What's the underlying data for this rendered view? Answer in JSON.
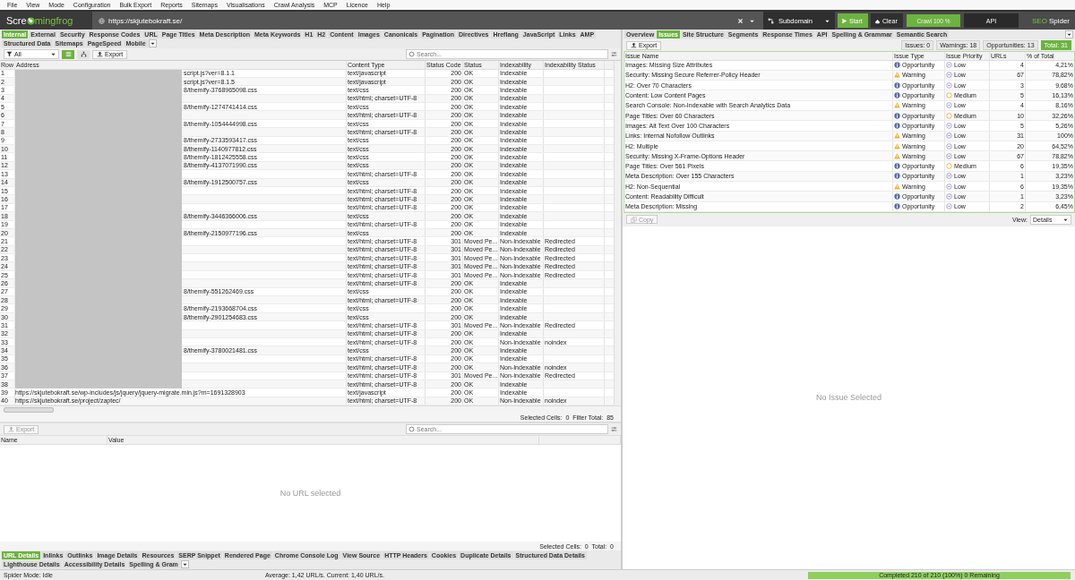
{
  "menu": [
    "File",
    "View",
    "Mode",
    "Configuration",
    "Bulk Export",
    "Reports",
    "Sitemaps",
    "Visualisations",
    "Crawl Analysis",
    "MCP",
    "Licence",
    "Help"
  ],
  "topbar": {
    "logo": [
      "Scre",
      "mingfrog"
    ],
    "url": "https://skjutebokraft.se/",
    "mode": "Subdomain",
    "start": "Start",
    "clear": "Clear",
    "crawl": {
      "label": "Crawl 100 %",
      "level": 1
    },
    "api": "API",
    "brand": [
      "SEO",
      "Spider"
    ]
  },
  "left": {
    "tabs": [
      {
        "label": "Internal",
        "selected": true
      },
      {
        "label": "External",
        "selected": false
      },
      {
        "label": "Security",
        "selected": false
      },
      {
        "label": "Response Codes",
        "selected": false
      },
      {
        "label": "URL",
        "selected": false
      },
      {
        "label": "Page Titles",
        "selected": false
      },
      {
        "label": "Meta Description",
        "selected": false
      },
      {
        "label": "Meta Keywords",
        "selected": false
      },
      {
        "label": "H1",
        "selected": false
      },
      {
        "label": "H2",
        "selected": false
      },
      {
        "label": "Content",
        "selected": false
      },
      {
        "label": "Images",
        "selected": false
      },
      {
        "label": "Canonicals",
        "selected": false
      },
      {
        "label": "Pagination",
        "selected": false
      },
      {
        "label": "Directives",
        "selected": false
      },
      {
        "label": "Hreflang",
        "selected": false
      },
      {
        "label": "JavaScript",
        "selected": false
      },
      {
        "label": "Links",
        "selected": false
      },
      {
        "label": "AMP",
        "selected": false
      },
      {
        "label": "Structured Data",
        "selected": false
      },
      {
        "label": "Sitemaps",
        "selected": false
      },
      {
        "label": "PageSpeed",
        "selected": false
      },
      {
        "label": "Mobile",
        "selected": false
      }
    ],
    "filter": "All",
    "views": [
      {
        "kind": "list",
        "selected": true
      },
      {
        "kind": "tree",
        "selected": false
      }
    ],
    "export": "Export",
    "search": {
      "placeholder": "Search..."
    },
    "table": {
      "columns": [
        "Row",
        "Address",
        "Content Type",
        "Status Code",
        "Status",
        "Indexability",
        "Indexability Status"
      ],
      "rows": [
        {
          "redacted": true,
          "cells": [
            "1",
            "script.js?ver=8.1.1",
            "text/javascript",
            "200",
            "OK",
            "Indexable",
            ""
          ]
        },
        {
          "redacted": true,
          "cells": [
            "2",
            "script.js?ver=8.1.5",
            "text/javascript",
            "200",
            "OK",
            "Indexable",
            ""
          ]
        },
        {
          "redacted": true,
          "cells": [
            "3",
            "8/themify-3768965098.css",
            "text/css",
            "200",
            "OK",
            "Indexable",
            ""
          ]
        },
        {
          "redacted": true,
          "cells": [
            "4",
            "",
            "text/html; charset=UTF-8",
            "200",
            "OK",
            "Indexable",
            ""
          ]
        },
        {
          "redacted": true,
          "cells": [
            "5",
            "8/themify-1274741414.css",
            "text/css",
            "200",
            "OK",
            "Indexable",
            ""
          ]
        },
        {
          "redacted": true,
          "cells": [
            "6",
            "",
            "text/html; charset=UTF-8",
            "200",
            "OK",
            "Indexable",
            ""
          ]
        },
        {
          "redacted": true,
          "cells": [
            "7",
            "8/themify-1054444998.css",
            "text/css",
            "200",
            "OK",
            "Indexable",
            ""
          ]
        },
        {
          "redacted": true,
          "cells": [
            "8",
            "",
            "text/html; charset=UTF-8",
            "200",
            "OK",
            "Indexable",
            ""
          ]
        },
        {
          "redacted": true,
          "cells": [
            "9",
            "8/themify-2733593417.css",
            "text/css",
            "200",
            "OK",
            "Indexable",
            ""
          ]
        },
        {
          "redacted": true,
          "cells": [
            "10",
            "8/themify-1140977812.css",
            "text/css",
            "200",
            "OK",
            "Indexable",
            ""
          ]
        },
        {
          "redacted": true,
          "cells": [
            "11",
            "8/themify-1812425558.css",
            "text/css",
            "200",
            "OK",
            "Indexable",
            ""
          ]
        },
        {
          "redacted": true,
          "cells": [
            "12",
            "8/themify-4137071990.css",
            "text/css",
            "200",
            "OK",
            "Indexable",
            ""
          ]
        },
        {
          "redacted": true,
          "cells": [
            "13",
            "",
            "text/html; charset=UTF-8",
            "200",
            "OK",
            "Indexable",
            ""
          ]
        },
        {
          "redacted": true,
          "cells": [
            "14",
            "8/themify-1912500757.css",
            "text/css",
            "200",
            "OK",
            "Indexable",
            ""
          ]
        },
        {
          "redacted": true,
          "cells": [
            "15",
            "",
            "text/html; charset=UTF-8",
            "200",
            "OK",
            "Indexable",
            ""
          ]
        },
        {
          "redacted": true,
          "cells": [
            "16",
            "",
            "text/html; charset=UTF-8",
            "200",
            "OK",
            "Indexable",
            ""
          ]
        },
        {
          "redacted": true,
          "cells": [
            "17",
            "",
            "text/html; charset=UTF-8",
            "200",
            "OK",
            "Indexable",
            ""
          ]
        },
        {
          "redacted": true,
          "cells": [
            "18",
            "8/themify-3446366006.css",
            "text/css",
            "200",
            "OK",
            "Indexable",
            ""
          ]
        },
        {
          "redacted": true,
          "cells": [
            "19",
            "",
            "text/html; charset=UTF-8",
            "200",
            "OK",
            "Indexable",
            ""
          ]
        },
        {
          "redacted": true,
          "cells": [
            "20",
            "8/themify-2150977196.css",
            "text/css",
            "200",
            "OK",
            "Indexable",
            ""
          ]
        },
        {
          "redacted": true,
          "cells": [
            "21",
            "",
            "text/html; charset=UTF-8",
            "301",
            "Moved Pe...",
            "Non-Indexable",
            "Redirected"
          ]
        },
        {
          "redacted": true,
          "cells": [
            "22",
            "",
            "text/html; charset=UTF-8",
            "301",
            "Moved Pe...",
            "Non-Indexable",
            "Redirected"
          ]
        },
        {
          "redacted": true,
          "cells": [
            "23",
            "",
            "text/html; charset=UTF-8",
            "301",
            "Moved Pe...",
            "Non-Indexable",
            "Redirected"
          ]
        },
        {
          "redacted": true,
          "cells": [
            "24",
            "",
            "text/html; charset=UTF-8",
            "301",
            "Moved Pe...",
            "Non-Indexable",
            "Redirected"
          ]
        },
        {
          "redacted": true,
          "cells": [
            "25",
            "",
            "text/html; charset=UTF-8",
            "301",
            "Moved Pe...",
            "Non-Indexable",
            "Redirected"
          ]
        },
        {
          "redacted": true,
          "cells": [
            "26",
            "",
            "text/html; charset=UTF-8",
            "200",
            "OK",
            "Indexable",
            ""
          ]
        },
        {
          "redacted": true,
          "cells": [
            "27",
            "8/themify-551262469.css",
            "text/css",
            "200",
            "OK",
            "Indexable",
            ""
          ]
        },
        {
          "redacted": true,
          "cells": [
            "28",
            "",
            "text/html; charset=UTF-8",
            "200",
            "OK",
            "Indexable",
            ""
          ]
        },
        {
          "redacted": true,
          "cells": [
            "29",
            "8/themify-2193668704.css",
            "text/css",
            "200",
            "OK",
            "Indexable",
            ""
          ]
        },
        {
          "redacted": true,
          "cells": [
            "30",
            "8/themify-2901254683.css",
            "text/css",
            "200",
            "OK",
            "Indexable",
            ""
          ]
        },
        {
          "redacted": true,
          "cells": [
            "31",
            "",
            "text/html; charset=UTF-8",
            "301",
            "Moved Pe...",
            "Non-Indexable",
            "Redirected"
          ]
        },
        {
          "redacted": true,
          "cells": [
            "32",
            "",
            "text/html; charset=UTF-8",
            "200",
            "OK",
            "Indexable",
            ""
          ]
        },
        {
          "redacted": true,
          "cells": [
            "33",
            "",
            "text/html; charset=UTF-8",
            "200",
            "OK",
            "Non-Indexable",
            "noindex"
          ]
        },
        {
          "redacted": true,
          "cells": [
            "34",
            "8/themify-3780021481.css",
            "text/css",
            "200",
            "OK",
            "Indexable",
            ""
          ]
        },
        {
          "redacted": true,
          "cells": [
            "35",
            "",
            "text/html; charset=UTF-8",
            "200",
            "OK",
            "Indexable",
            ""
          ]
        },
        {
          "redacted": true,
          "cells": [
            "36",
            "",
            "text/html; charset=UTF-8",
            "200",
            "OK",
            "Non-Indexable",
            "noindex"
          ]
        },
        {
          "redacted": true,
          "cells": [
            "37",
            "",
            "text/html; charset=UTF-8",
            "301",
            "Moved Pe...",
            "Non-Indexable",
            "Redirected"
          ]
        },
        {
          "redacted": true,
          "cells": [
            "38",
            "",
            "text/html; charset=UTF-8",
            "200",
            "OK",
            "Indexable",
            ""
          ]
        },
        {
          "redacted": false,
          "cells": [
            "39",
            "https://skjutebokraft.se/wp-includes/js/jquery/jquery-migrate.min.js?m=1691328903",
            "text/javascript",
            "200",
            "OK",
            "Indexable",
            ""
          ]
        },
        {
          "redacted": false,
          "cells": [
            "40",
            "https://skjutebokraft.se/project/zaptec/",
            "text/html; charset=UTF-8",
            "200",
            "OK",
            "Non-Indexable",
            "noindex"
          ]
        }
      ]
    },
    "summary": "Selected Cells:  0  Filter Total:  85"
  },
  "details": {
    "export": "Export",
    "search": {
      "placeholder": "Search..."
    },
    "columns": [
      "Name",
      "Value"
    ],
    "empty": "No URL selected",
    "summary": "Selected Cells:  0  Total:  0",
    "tabs": [
      {
        "label": "URL Details",
        "selected": true
      },
      {
        "label": "Inlinks",
        "selected": false
      },
      {
        "label": "Outlinks",
        "selected": false
      },
      {
        "label": "Image Details",
        "selected": false
      },
      {
        "label": "Resources",
        "selected": false
      },
      {
        "label": "SERP Snippet",
        "selected": false
      },
      {
        "label": "Rendered Page",
        "selected": false
      },
      {
        "label": "Chrome Console Log",
        "selected": false
      },
      {
        "label": "View Source",
        "selected": false
      },
      {
        "label": "HTTP Headers",
        "selected": false
      },
      {
        "label": "Cookies",
        "selected": false
      },
      {
        "label": "Duplicate Details",
        "selected": false
      },
      {
        "label": "Structured Data Details",
        "selected": false
      },
      {
        "label": "Lighthouse Details",
        "selected": false
      },
      {
        "label": "Accessibility Details",
        "selected": false
      },
      {
        "label": "Spelling & Gram",
        "selected": false
      }
    ]
  },
  "right": {
    "tabs": [
      {
        "label": "Overview",
        "selected": false
      },
      {
        "label": "Issues",
        "selected": true
      },
      {
        "label": "Site Structure",
        "selected": false
      },
      {
        "label": "Segments",
        "selected": false
      },
      {
        "label": "Response Times",
        "selected": false
      },
      {
        "label": "API",
        "selected": false
      },
      {
        "label": "Spelling & Grammar",
        "selected": false
      },
      {
        "label": "Semantic Search",
        "selected": false
      }
    ],
    "export": "Export",
    "counters": [
      {
        "label": "Issues: 0",
        "selected": false
      },
      {
        "label": "Warnings: 18",
        "selected": false
      },
      {
        "label": "Opportunities: 13",
        "selected": false
      },
      {
        "label": "Total: 31",
        "selected": true
      }
    ],
    "columns": [
      "Issue Name",
      "Issue Type",
      "Issue Priority",
      "URLs",
      "% of Total"
    ],
    "issues": [
      {
        "name": "Images: Missing Size Attributes",
        "type": {
          "label": "Opportunity",
          "kind": "opportunity"
        },
        "priority": {
          "label": "Low",
          "kind": "low"
        },
        "urls": "4",
        "pct": "4,21%"
      },
      {
        "name": "Security: Missing Secure Referrer-Policy Header",
        "type": {
          "label": "Warning",
          "kind": "warning"
        },
        "priority": {
          "label": "Low",
          "kind": "low"
        },
        "urls": "67",
        "pct": "78,82%"
      },
      {
        "name": "H2: Over 70 Characters",
        "type": {
          "label": "Opportunity",
          "kind": "opportunity"
        },
        "priority": {
          "label": "Low",
          "kind": "low"
        },
        "urls": "3",
        "pct": "9,68%"
      },
      {
        "name": "Content: Low Content Pages",
        "type": {
          "label": "Opportunity",
          "kind": "opportunity"
        },
        "priority": {
          "label": "Medium",
          "kind": "medium"
        },
        "urls": "5",
        "pct": "16,13%"
      },
      {
        "name": "Search Console: Non-Indexable with Search Analytics Data",
        "type": {
          "label": "Warning",
          "kind": "warning"
        },
        "priority": {
          "label": "Low",
          "kind": "low"
        },
        "urls": "4",
        "pct": "8,16%"
      },
      {
        "name": "Page Titles: Over 60 Characters",
        "type": {
          "label": "Opportunity",
          "kind": "opportunity"
        },
        "priority": {
          "label": "Medium",
          "kind": "medium"
        },
        "urls": "10",
        "pct": "32,26%"
      },
      {
        "name": "Images: Alt Text Over 100 Characters",
        "type": {
          "label": "Opportunity",
          "kind": "opportunity"
        },
        "priority": {
          "label": "Low",
          "kind": "low"
        },
        "urls": "5",
        "pct": "5,26%"
      },
      {
        "name": "Links: Internal Nofollow Outlinks",
        "type": {
          "label": "Warning",
          "kind": "warning"
        },
        "priority": {
          "label": "Low",
          "kind": "low"
        },
        "urls": "31",
        "pct": "100%"
      },
      {
        "name": "H2: Multiple",
        "type": {
          "label": "Warning",
          "kind": "warning"
        },
        "priority": {
          "label": "Low",
          "kind": "low"
        },
        "urls": "20",
        "pct": "64,52%"
      },
      {
        "name": "Security: Missing X-Frame-Options Header",
        "type": {
          "label": "Warning",
          "kind": "warning"
        },
        "priority": {
          "label": "Low",
          "kind": "low"
        },
        "urls": "67",
        "pct": "78,82%"
      },
      {
        "name": "Page Titles: Over 561 Pixels",
        "type": {
          "label": "Opportunity",
          "kind": "opportunity"
        },
        "priority": {
          "label": "Medium",
          "kind": "medium"
        },
        "urls": "6",
        "pct": "19,35%"
      },
      {
        "name": "Meta Description: Over 155 Characters",
        "type": {
          "label": "Opportunity",
          "kind": "opportunity"
        },
        "priority": {
          "label": "Low",
          "kind": "low"
        },
        "urls": "1",
        "pct": "3,23%"
      },
      {
        "name": "H2: Non-Sequential",
        "type": {
          "label": "Warning",
          "kind": "warning"
        },
        "priority": {
          "label": "Low",
          "kind": "low"
        },
        "urls": "6",
        "pct": "19,35%"
      },
      {
        "name": "Content: Readability Difficult",
        "type": {
          "label": "Opportunity",
          "kind": "opportunity"
        },
        "priority": {
          "label": "Low",
          "kind": "low"
        },
        "urls": "1",
        "pct": "3,23%"
      },
      {
        "name": "Meta Description: Missing",
        "type": {
          "label": "Opportunity",
          "kind": "opportunity"
        },
        "priority": {
          "label": "Low",
          "kind": "low"
        },
        "urls": "2",
        "pct": "6,45%"
      }
    ],
    "copy": "Copy",
    "view_label": "View:",
    "view": "Details",
    "empty": "No Issue Selected"
  },
  "status_bar": {
    "mode": "Spider Mode: Idle",
    "speed": "Average: 1,42 URL/s. Current: 1,40 URL/s.",
    "progress": {
      "label": "Completed 210 of 210 (100%) 0 Remaining",
      "level": 1
    }
  }
}
